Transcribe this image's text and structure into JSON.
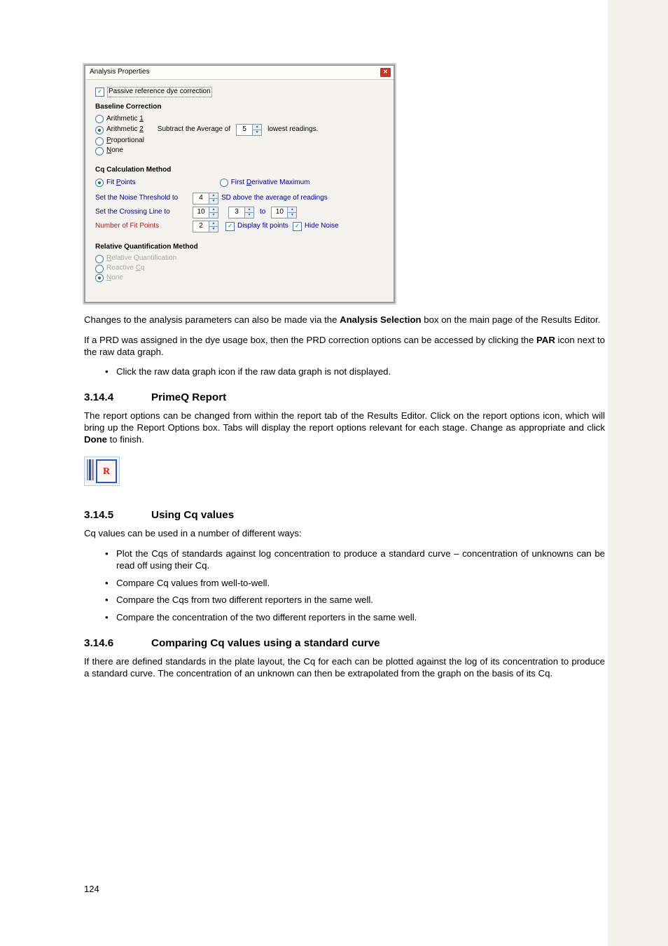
{
  "dialog": {
    "title": "Analysis Properties",
    "close_x": "✕",
    "passive_label": "Passive reference dye correction",
    "passive_checked": true,
    "baseline": {
      "heading": "Baseline Correction",
      "opt_arith1": {
        "pre": "Arithmetic ",
        "u": "1",
        "post": ""
      },
      "opt_arith2": {
        "pre": "Arithmetic ",
        "u": "2",
        "post": ""
      },
      "opt_prop": {
        "pre": "",
        "u": "P",
        "post": "roportional"
      },
      "opt_none": {
        "pre": "",
        "u": "N",
        "post": "one"
      },
      "selected": "arith2",
      "subtract_pre": "Subtract the Average of",
      "subtract_val": "5",
      "subtract_post": "lowest readings."
    },
    "cq": {
      "heading": "Cq Calculation Method",
      "fit_label": {
        "pre": "Fit ",
        "u": "P",
        "post": "oints"
      },
      "fdm_label": {
        "pre": "First ",
        "u": "D",
        "post": "erivative Maximum"
      },
      "selected": "fit",
      "noise_label": "Set the Noise Threshold to",
      "noise_val": "4",
      "noise_post": "SD above the average of readings",
      "cross_label": "Set the Crossing Line to",
      "cross_val": "10",
      "cross_from": "3",
      "cross_to_word": "to",
      "cross_to": "10",
      "fitpts_label": "Number of Fit Points",
      "fitpts_val": "2",
      "display_fit": "Display fit points",
      "hide_noise": "Hide Noise"
    },
    "rq": {
      "heading": "Relative Quantification Method",
      "opt_rel": {
        "pre": "",
        "u": "R",
        "post": "elative Quantification"
      },
      "opt_rcq": {
        "pre": "Reactive ",
        "u": "C",
        "post": "q"
      },
      "opt_none": {
        "pre": "",
        "u": "N",
        "post": "one"
      },
      "selected": "none"
    }
  },
  "body": {
    "p1_a": "Changes to the analysis parameters can also be made via the ",
    "p1_b": "Analysis Selection",
    "p1_c": " box on the main page of the Results Editor.",
    "p2_a": "If a PRD was assigned in the dye usage box, then the PRD correction options can be accessed by clicking the ",
    "p2_b": "PAR",
    "p2_c": " icon next to the raw data graph.",
    "b1": "Click the raw data graph icon if the raw data graph is not displayed.",
    "h1_num": "3.14.4",
    "h1_txt": "PrimeQ Report",
    "p3_a": "The report options can be changed from within the report tab of the Results Editor. Click on the report options icon, which will bring up the Report Options box. Tabs will display the report options relevant for each stage. Change as appropriate and click ",
    "p3_b": "Done",
    "p3_c": " to finish.",
    "icon_letter": "R",
    "h2_num": "3.14.5",
    "h2_txt": "Using Cq values",
    "p4": "Cq values can be used in a number of different ways:",
    "b2": "Plot the Cqs of standards against log concentration to produce a standard curve – concentration of unknowns can be read off using their Cq.",
    "b3": "Compare Cq values from well-to-well.",
    "b4": "Compare the Cqs from two different reporters in the same well.",
    "b5": "Compare the concentration of the two different reporters in the same well.",
    "h3_num": "3.14.6",
    "h3_txt": "Comparing Cq values using a standard curve",
    "p5": "If there are defined standards in the plate layout, the Cq for each can be plotted against the log of its concentration to produce a standard curve. The concentration of an unknown can then be extrapolated from the graph on the basis of its Cq.",
    "page_num": "124"
  }
}
